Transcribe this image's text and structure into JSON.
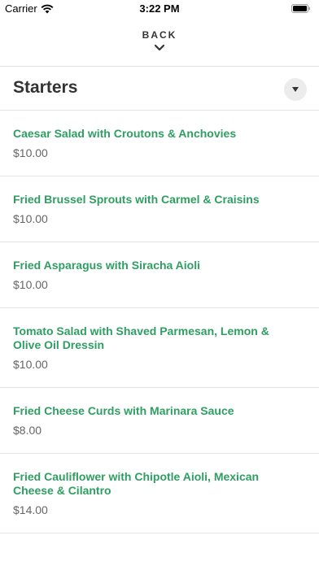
{
  "status_bar": {
    "carrier": "Carrier",
    "time": "3:22 PM"
  },
  "nav": {
    "back_label": "BACK"
  },
  "section": {
    "title": "Starters"
  },
  "menu_items": [
    {
      "name": "Caesar Salad with Croutons & Anchovies",
      "price": "$10.00"
    },
    {
      "name": "Fried Brussel Sprouts with Carmel & Craisins",
      "price": "$10.00"
    },
    {
      "name": "Fried Asparagus with Siracha Aioli",
      "price": "$10.00"
    },
    {
      "name": "Tomato Salad with Shaved Parmesan, Lemon & Olive Oil Dressin",
      "price": "$10.00"
    },
    {
      "name": "Fried Cheese Curds with Marinara Sauce",
      "price": "$8.00"
    },
    {
      "name": "Fried Cauliflower with Chipotle Aioli, Mexican Cheese & Cilantro",
      "price": "$14.00"
    }
  ],
  "colors": {
    "accent": "#2e9e62",
    "price": "#666666"
  }
}
